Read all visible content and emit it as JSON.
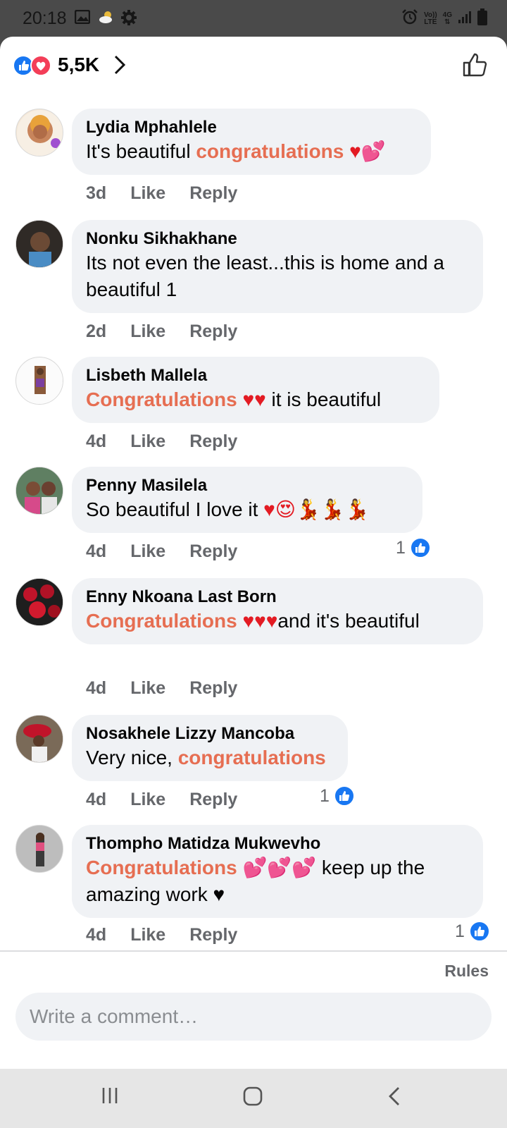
{
  "status_bar": {
    "time": "20:18",
    "volte": "Vo))",
    "lte": "LTE",
    "net": "4G"
  },
  "header": {
    "reaction_count": "5,5K"
  },
  "comments": [
    {
      "author": "Lydia Mphahlele",
      "text_before": "It's beautiful ",
      "accent": "congratulations",
      "emoji": " ♥💕",
      "text_after": "",
      "age": "3d",
      "like": "Like",
      "reply": "Reply",
      "reactions": ""
    },
    {
      "author": "Nonku Sikhakhane",
      "text_before": "Its not even the least...this is home and a beautiful 1",
      "accent": "",
      "emoji": "",
      "text_after": "",
      "age": "2d",
      "like": "Like",
      "reply": "Reply",
      "reactions": ""
    },
    {
      "author": "Lisbeth Mallela",
      "text_before": "",
      "accent": "Congratulations",
      "emoji": " ♥♥",
      "text_after": " it is beautiful",
      "age": "4d",
      "like": "Like",
      "reply": "Reply",
      "reactions": ""
    },
    {
      "author": "Penny Masilela",
      "text_before": "So beautiful I love it ",
      "accent": "",
      "emoji": "♥😍💃💃💃",
      "text_after": "",
      "age": "4d",
      "like": "Like",
      "reply": "Reply",
      "reactions": "1"
    },
    {
      "author": "Enny Nkoana Last Born",
      "text_before": "",
      "accent": "Congratulations",
      "emoji": " ♥♥♥",
      "text_after": "and it's beautiful",
      "age": "4d",
      "like": "Like",
      "reply": "Reply",
      "reactions": ""
    },
    {
      "author": "Nosakhele Lizzy Mancoba",
      "text_before": "Very nice, ",
      "accent": "congratulations",
      "emoji": "",
      "text_after": "",
      "age": "4d",
      "like": "Like",
      "reply": "Reply",
      "reactions": "1"
    },
    {
      "author": "Thompho Matidza Mukwevho",
      "text_before": "",
      "accent": "Congratulations",
      "emoji": " 💕💕💕",
      "text_after": " keep up the amazing work ♥",
      "age": "4d",
      "like": "Like",
      "reply": "Reply",
      "reactions": "1"
    }
  ],
  "footer": {
    "rules": "Rules",
    "composer_placeholder": "Write a comment…"
  },
  "colors": {
    "accent": "#e66e52",
    "like_blue": "#1877f2",
    "love_red": "#f33e58",
    "bubble": "#f0f2f5"
  }
}
